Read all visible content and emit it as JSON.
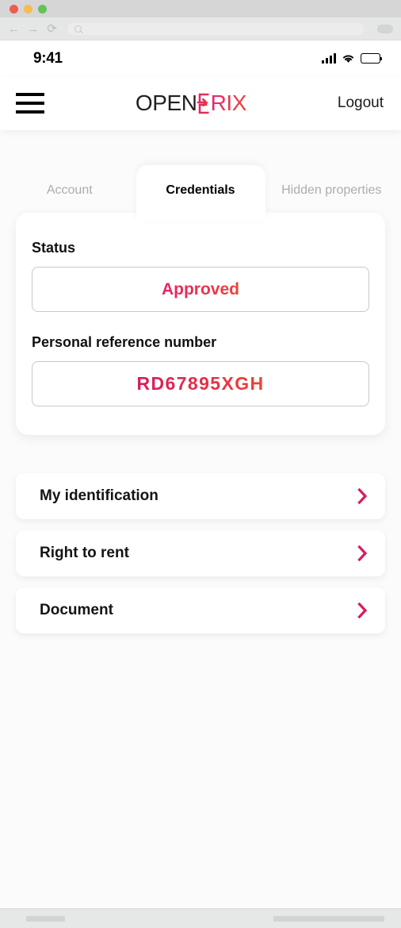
{
  "browser": {
    "traffic_lights": [
      "close",
      "minimize",
      "maximize"
    ],
    "back_glyph": "←",
    "forward_glyph": "→",
    "reload_glyph": "⟳",
    "omnibox_value": "",
    "omnibox_placeholder": ""
  },
  "status_bar": {
    "time": "9:41",
    "signal_icon": "cellular-signal-icon",
    "wifi_icon": "wifi-icon",
    "battery_icon": "battery-full-icon"
  },
  "header": {
    "menu_icon": "hamburger-menu-icon",
    "logo": {
      "part_black": "OPEN",
      "part_mark": "B",
      "part_gradient": "RIX",
      "full_text": "OPENBRIX"
    },
    "logout_label": "Logout"
  },
  "tabs": [
    {
      "label": "Account",
      "active": false
    },
    {
      "label": "Credentials",
      "active": true
    },
    {
      "label": "Hidden properties",
      "active": false
    }
  ],
  "credentials": {
    "status_label": "Status",
    "status_value": "Approved",
    "reference_label": "Personal reference number",
    "reference_value": "RD67895XGH"
  },
  "link_rows": [
    {
      "label": "My identification",
      "chevron": "chevron-right-icon"
    },
    {
      "label": "Right to rent",
      "chevron": "chevron-right-icon"
    },
    {
      "label": "Document",
      "chevron": "chevron-right-icon"
    }
  ],
  "colors": {
    "accent_pink": "#d81b60",
    "accent_red": "#ef4136",
    "page_background": "#fbfbfb",
    "card_background": "#ffffff",
    "text_primary": "#111111",
    "text_muted": "#adadad"
  }
}
